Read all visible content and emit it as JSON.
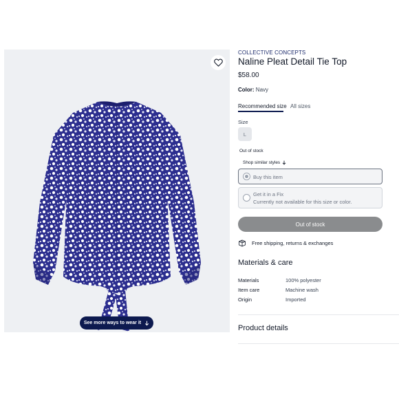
{
  "image": {
    "alt_name": "navy floral blouse",
    "favorite_icon": "heart-icon",
    "see_more_label": "See more ways to wear it",
    "see_more_icon": "arrow-down-icon"
  },
  "product": {
    "brand": "COLLECTIVE CONCEPTS",
    "title": "Naline Pleat Detail Tie Top",
    "price": "$58.00",
    "color_label": "Color:",
    "color_value": "Navy"
  },
  "tabs": [
    {
      "label": "Recommended size",
      "active": true
    },
    {
      "label": "All sizes",
      "active": false
    }
  ],
  "size": {
    "label": "Size",
    "options": [
      "L"
    ],
    "status": "Out of stock",
    "shop_similar": "Shop similar styles"
  },
  "purchase_options": {
    "buy": "Buy this item",
    "fix_title": "Get it in a Fix",
    "fix_note": "Currently not available for this size or color."
  },
  "cta": {
    "label": "Out of stock"
  },
  "shipping": {
    "label": "Free shipping, returns & exchanges",
    "icon": "box-icon"
  },
  "materials": {
    "heading": "Materials & care",
    "rows": [
      {
        "key": "Materials",
        "value": "100% polyester"
      },
      {
        "key": "Item care",
        "value": "Machine wash"
      },
      {
        "key": "Origin",
        "value": "Imported"
      }
    ]
  },
  "product_details": {
    "heading": "Product details"
  },
  "colors": {
    "accent_navy": "#0d1a4f",
    "brand_text": "#1b2a6b",
    "disabled_button": "#8a8c8e",
    "image_bg": "#eef0f3"
  }
}
